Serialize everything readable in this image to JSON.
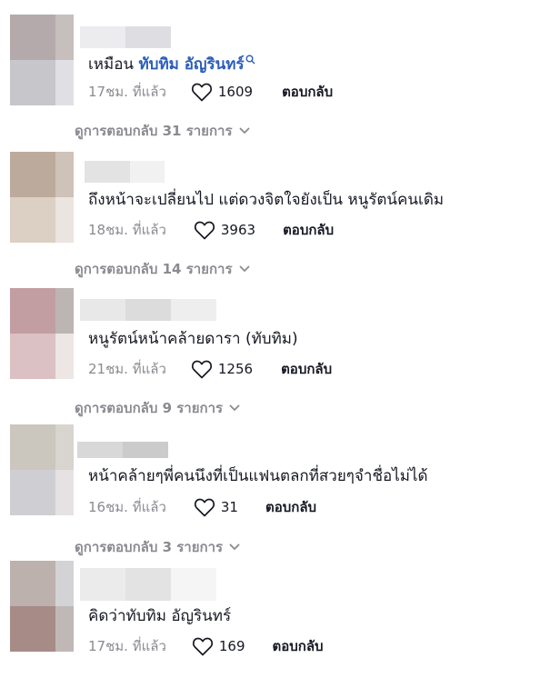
{
  "comments": [
    {
      "avatar_colors": [
        "#b4aaab",
        "#c6bfbe",
        "#c7c6cb",
        "#e0dfe4"
      ],
      "name_colors": [
        "#ececef",
        "#dedde2",
        "#ffffff"
      ],
      "text": "เหมือน ",
      "mention": "ทับทิม อัญรินทร์",
      "time": "17ชม. ที่แล้ว",
      "likes": "1609",
      "reply_label": "ตอบกลับ",
      "view_replies": "ดูการตอบกลับ 31 รายการ"
    },
    {
      "avatar_colors": [
        "#bcab9c",
        "#cfc2b8",
        "#dccfc4",
        "#ebe4e0"
      ],
      "name_colors": [
        "#e3e3e3",
        "#f1f1f1",
        "#ffffff"
      ],
      "text": "ถึงหน้าจะเปลี่ยนไป แต่ดวงจิตใจยังเป็น หนูรัตน์คนเดิม",
      "mention": "",
      "time": "18ชม. ที่แล้ว",
      "likes": "3963",
      "reply_label": "ตอบกลับ",
      "view_replies": "ดูการตอบกลับ 14 รายการ"
    },
    {
      "avatar_colors": [
        "#c29da2",
        "#bdb4b4",
        "#dbc1c4",
        "#ede6e4"
      ],
      "name_colors": [
        "#e8e8e8",
        "#dcdcdc",
        "#eeeeee"
      ],
      "text": "หนูรัตน์หน้าคล้ายดารา (ทับทิม)",
      "mention": "",
      "time": "21ชม. ที่แล้ว",
      "likes": "1256",
      "reply_label": "ตอบกลับ",
      "view_replies": "ดูการตอบกลับ 9 รายการ"
    },
    {
      "avatar_colors": [
        "#cbc6be",
        "#d8d5ce",
        "#cfcfd3",
        "#e6e2e3"
      ],
      "name_colors": [
        "#d8d8d8",
        "#cbcbcb",
        "#ffffff"
      ],
      "text": "หน้าคล้ายๆพี่คนนึงที่เป็นแฟนตลกที่สวยๆจำชื่อไม่ได้",
      "mention": "",
      "time": "16ชม. ที่แล้ว",
      "likes": "31",
      "reply_label": "ตอบกลับ",
      "view_replies": "ดูการตอบกลับ 3 รายการ"
    },
    {
      "avatar_colors": [
        "#bdb1ad",
        "#d3d3d6",
        "#a78b86",
        "#c0b8b6"
      ],
      "name_colors": [
        "#ebebeb",
        "#e3e3e3",
        "#f5f5f5"
      ],
      "text": "คิดว่าทับทิม อัญรินทร์",
      "mention": "",
      "time": "17ชม. ที่แล้ว",
      "likes": "169",
      "reply_label": "ตอบกลับ",
      "view_replies": ""
    }
  ],
  "icons": {
    "like": "heart-outline-icon",
    "expand": "chevron-down-icon",
    "mention_search": "search-icon"
  }
}
